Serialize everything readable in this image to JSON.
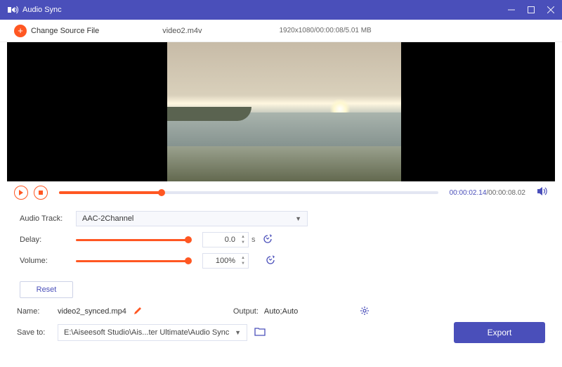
{
  "title": "Audio Sync",
  "toolbar": {
    "change_label": "Change Source File",
    "filename": "video2.m4v",
    "metadata": "1920x1080/00:00:08/5.01 MB"
  },
  "player": {
    "current_time": "00:00:02.14",
    "total_time": "/00:00:08.02"
  },
  "audio_track": {
    "label": "Audio Track:",
    "value": "AAC-2Channel"
  },
  "delay": {
    "label": "Delay:",
    "value": "0.0",
    "unit": "s"
  },
  "volume": {
    "label": "Volume:",
    "value": "100%"
  },
  "reset": "Reset",
  "name": {
    "label": "Name:",
    "value": "video2_synced.mp4"
  },
  "output": {
    "label": "Output:",
    "value": "Auto;Auto"
  },
  "saveto": {
    "label": "Save to:",
    "value": "E:\\Aiseesoft Studio\\Ais...ter Ultimate\\Audio Sync"
  },
  "export": "Export"
}
